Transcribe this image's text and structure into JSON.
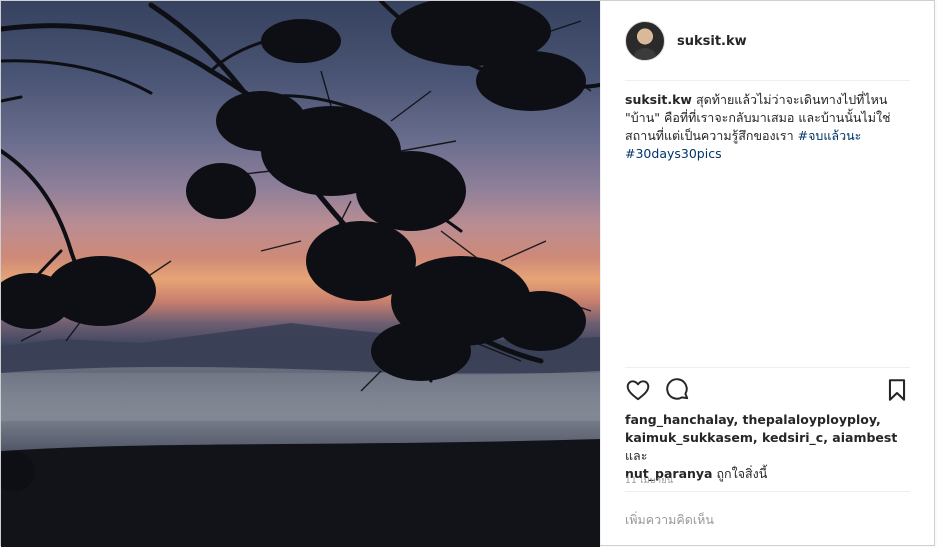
{
  "post": {
    "username": "suksit.kw",
    "caption": {
      "username": "suksit.kw",
      "text": "สุดท้ายแล้วไม่ว่าจะเดินทางไปที่ไหน \"บ้าน\" คือที่ที่เราจะกลับมาเสมอ และบ้านนั้นไม่ใช่สถานที่แต่เป็นความรู้สึกของเรา",
      "hashtags": [
        "#จบแล้วนะ",
        "#30days30pics"
      ]
    },
    "likes": {
      "users_line1": "fang_hanchalay, thepalaloyployploy,",
      "users_line2": "kaimuk_sukkasem, kedsiri_c, aiambest",
      "joiner": "และ",
      "last_user": "nut_paranya",
      "suffix": "ถูกใจสิ่งนี้"
    },
    "date": "11 เมษายน",
    "comment_placeholder": "เพิ่มความคิดเห็น"
  },
  "icons": {
    "like": "heart-icon",
    "comment": "comment-bubble-icon",
    "save": "bookmark-icon"
  },
  "colors": {
    "hashtag": "#003569",
    "text": "#262626",
    "muted": "#999999",
    "divider": "#efefef"
  }
}
